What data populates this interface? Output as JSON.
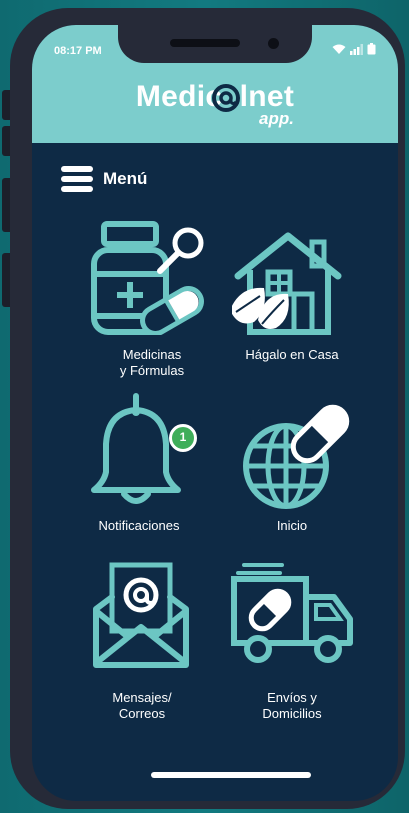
{
  "status_bar": {
    "time": "08:17 PM"
  },
  "header": {
    "logo_main": "Medic  lnet",
    "logo_sub": "app."
  },
  "menu": {
    "label": "Menú"
  },
  "tiles": [
    {
      "label": "Medicinas\ny Fórmulas",
      "icon": "medicine-bottle-icon"
    },
    {
      "label": "Hágalo en Casa",
      "icon": "house-icon"
    },
    {
      "label": "Notificaciones",
      "icon": "bell-icon",
      "badge": "1"
    },
    {
      "label": "Inicio",
      "icon": "globe-icon"
    },
    {
      "label": "Mensajes/\nCorreos",
      "icon": "mail-icon"
    },
    {
      "label": "Envíos y\nDomicilios",
      "icon": "delivery-truck-icon"
    }
  ],
  "colors": {
    "header": "#7ccdcc",
    "screen": "#0e2a45",
    "accent": "#6cc6c3",
    "badge": "#3fae5a"
  }
}
